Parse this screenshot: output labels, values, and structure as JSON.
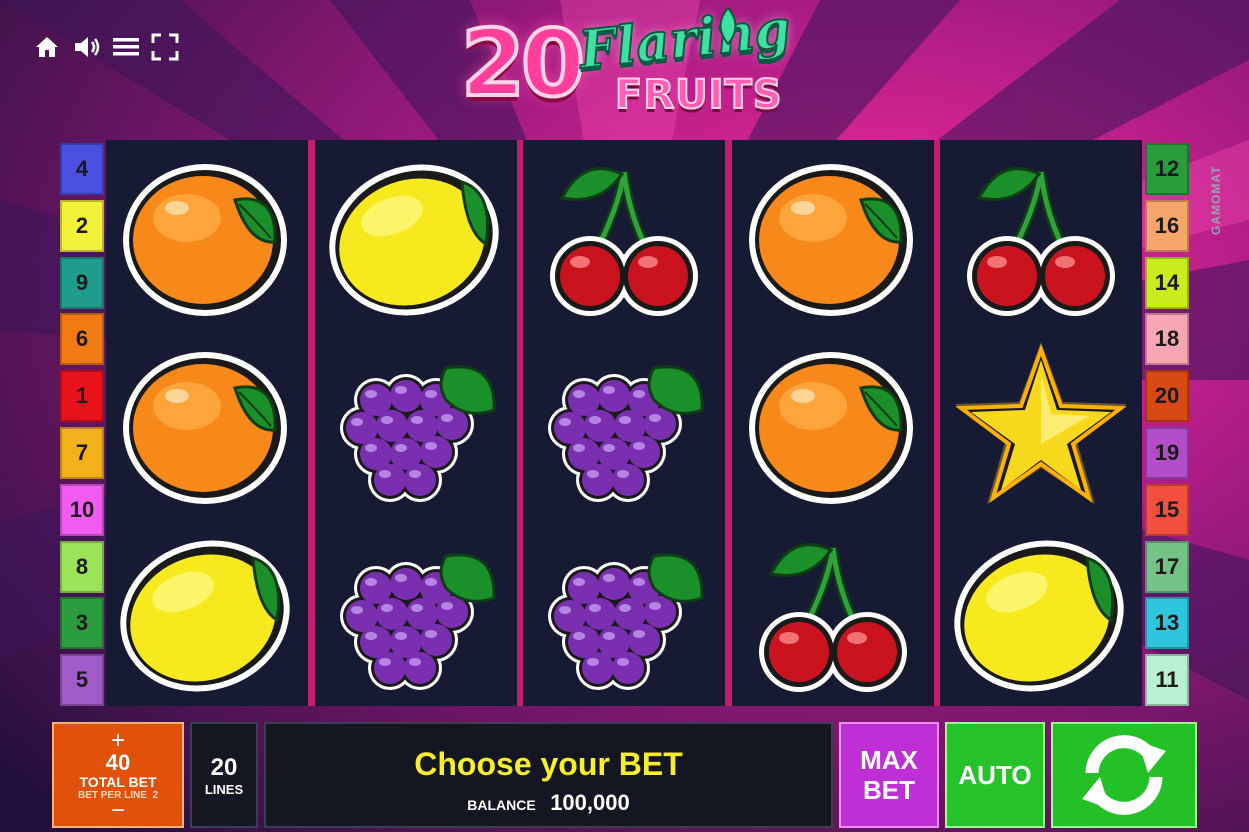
{
  "logo": {
    "number": "20",
    "word1": "Flaring",
    "word2": "FRUITS"
  },
  "top_controls": [
    "home-icon",
    "sound-icon",
    "menu-icon",
    "fullscreen-icon"
  ],
  "brand": "GAMOMAT",
  "lines_left": [
    {
      "label": "4",
      "color": "#4a4fe0"
    },
    {
      "label": "2",
      "color": "#f2f23a"
    },
    {
      "label": "9",
      "color": "#1f9c8c"
    },
    {
      "label": "6",
      "color": "#f27a12"
    },
    {
      "label": "1",
      "color": "#e8121b"
    },
    {
      "label": "7",
      "color": "#f2b11a"
    },
    {
      "label": "10",
      "color": "#f05cf0"
    },
    {
      "label": "8",
      "color": "#9be45a"
    },
    {
      "label": "3",
      "color": "#2b9d3e"
    },
    {
      "label": "5",
      "color": "#a05cc8"
    }
  ],
  "lines_right": [
    {
      "label": "12",
      "color": "#2a9c3c"
    },
    {
      "label": "16",
      "color": "#f7a56a"
    },
    {
      "label": "14",
      "color": "#c9ec1e"
    },
    {
      "label": "18",
      "color": "#f9a6b4"
    },
    {
      "label": "20",
      "color": "#d84a14"
    },
    {
      "label": "19",
      "color": "#b24cc8"
    },
    {
      "label": "15",
      "color": "#f2503e"
    },
    {
      "label": "17",
      "color": "#74c285"
    },
    {
      "label": "13",
      "color": "#2ec6dc"
    },
    {
      "label": "11",
      "color": "#b9f0d2"
    }
  ],
  "reels": [
    [
      "orange",
      "orange",
      "lemon"
    ],
    [
      "lemon",
      "grapes",
      "grapes"
    ],
    [
      "cherry",
      "grapes",
      "grapes"
    ],
    [
      "orange",
      "orange",
      "cherry"
    ],
    [
      "cherry",
      "star",
      "lemon"
    ]
  ],
  "bet": {
    "plus": "+",
    "value": "40",
    "label": "TOTAL BET",
    "per_line": "BET PER LINE  2",
    "minus": "−"
  },
  "lines": {
    "value": "20",
    "label": "LINES"
  },
  "message": "Choose your BET",
  "balance": {
    "label": "BALANCE",
    "value": "100,000"
  },
  "buttons": {
    "max_bet_1": "MAX",
    "max_bet_2": "BET",
    "auto": "AUTO"
  },
  "colors": {
    "max_bet": "#bf2fd6",
    "auto": "#26c22a",
    "spin": "#24c027",
    "bet_panel": "#e0520c",
    "message": "#f7ef2a"
  }
}
